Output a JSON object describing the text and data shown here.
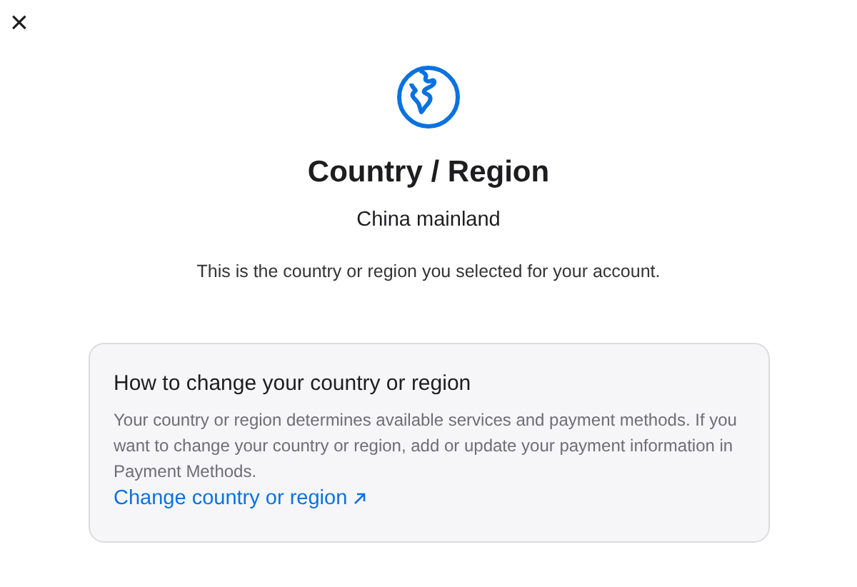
{
  "close_label": "×",
  "title": "Country / Region",
  "country": "China mainland",
  "description": "This is the country or region you selected for your account.",
  "card": {
    "heading": "How to change your country or region",
    "body": "Your country or region determines available services and payment methods. If you want to change your country or region, add or update your payment information in Payment Methods.",
    "link": "Change country or region"
  }
}
